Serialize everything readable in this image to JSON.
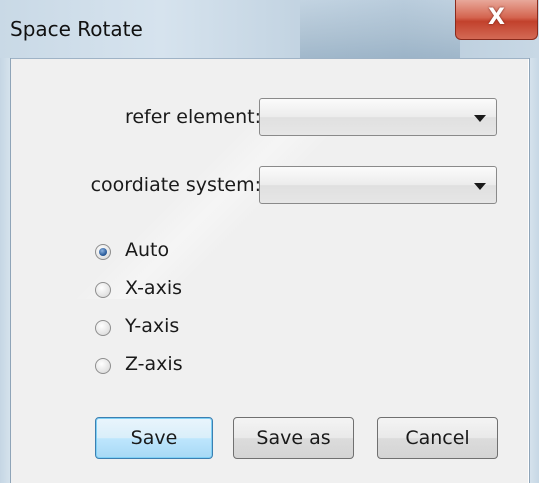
{
  "window": {
    "title": "Space Rotate",
    "close_glyph": "X"
  },
  "form": {
    "refer_element_label": "refer element:",
    "refer_element_value": "",
    "coordinate_system_label": "coordiate system:",
    "coordinate_system_value": ""
  },
  "radio_options": [
    {
      "label": "Auto",
      "checked": true
    },
    {
      "label": "X-axis",
      "checked": false
    },
    {
      "label": "Y-axis",
      "checked": false
    },
    {
      "label": "Z-axis",
      "checked": false
    }
  ],
  "buttons": {
    "save_label": "Save",
    "save_as_label": "Save as",
    "cancel_label": "Cancel"
  },
  "icons": {
    "close": "close-icon",
    "dropdown": "chevron-down-icon"
  },
  "colors": {
    "default_button_border": "#3c7fb1",
    "close_button": "#c2412c",
    "dialog_background": "#f0f0f0"
  }
}
